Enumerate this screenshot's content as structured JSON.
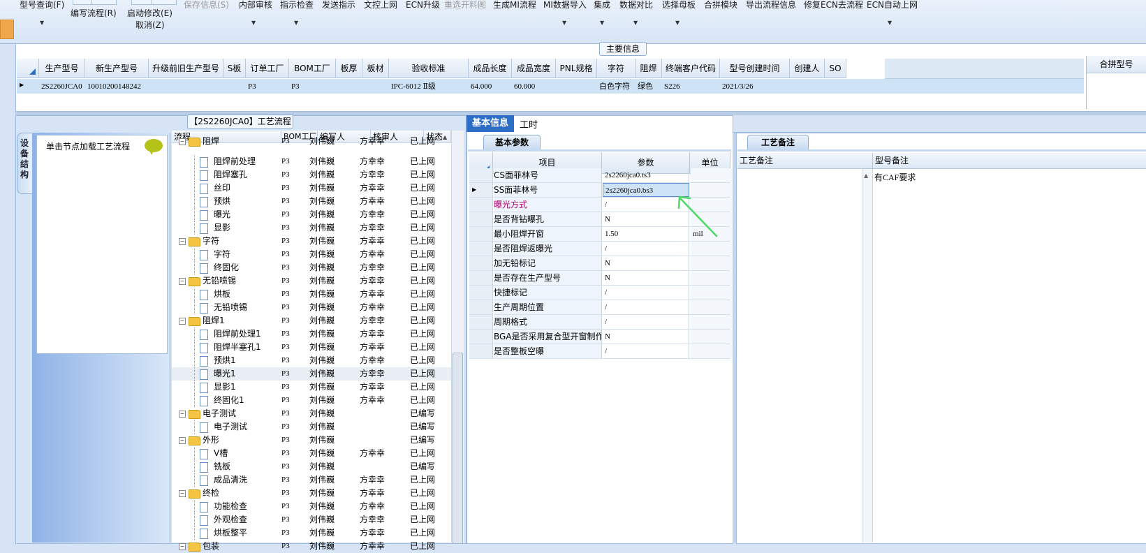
{
  "toolbar": {
    "items": [
      {
        "label": "型号查询(F)",
        "disabled": false
      },
      {
        "label": "编写流程(R)",
        "disabled": false
      },
      {
        "label": "启动修改(E)",
        "disabled": false
      },
      {
        "label": "取消(Z)",
        "disabled": false
      },
      {
        "label": "保存信息(S)",
        "disabled": true
      },
      {
        "label": "内部审核",
        "disabled": false
      },
      {
        "label": "指示检查",
        "disabled": false
      },
      {
        "label": "发送指示",
        "disabled": false
      },
      {
        "label": "文控上网",
        "disabled": false
      },
      {
        "label": "ECN升级",
        "disabled": false
      },
      {
        "label": "重选开料图",
        "disabled": true
      },
      {
        "label": "生成MI流程",
        "disabled": false
      },
      {
        "label": "MI数据导入",
        "disabled": false
      },
      {
        "label": "集成",
        "disabled": false
      },
      {
        "label": "数据对比",
        "disabled": false
      },
      {
        "label": "选择母板",
        "disabled": false
      },
      {
        "label": "合拼模块",
        "disabled": false
      },
      {
        "label": "导出流程信息",
        "disabled": false
      },
      {
        "label": "修复ECN去流程",
        "disabled": false
      },
      {
        "label": "ECN自动上网",
        "disabled": false
      }
    ]
  },
  "main_info": {
    "title": "主要信息",
    "columns": [
      "生产型号",
      "新生产型号",
      "升级前旧生产型号",
      "S板",
      "订单工厂",
      "BOM工厂",
      "板厚",
      "板材",
      "验收标准",
      "成品长度",
      "成品宽度",
      "PNL规格",
      "字符",
      "阻焊",
      "终端客户代码",
      "型号创建时间",
      "创建人",
      "SO"
    ],
    "row": [
      "2S2260JCA0",
      "10010200148242",
      "",
      "",
      "P3",
      "P3",
      "",
      "",
      "IPC-6012 Ⅱ级",
      "64.000",
      "60.000",
      "",
      "白色字符",
      "绿色",
      "S226",
      "2021/3/26",
      "",
      ""
    ],
    "merge_label": "合拼型号"
  },
  "flow_panel": {
    "title": "【2S2260JCA0】工艺流程",
    "side_tab": "设备结构",
    "node_hint": "单击节点加载工艺流程",
    "columns": [
      "流程",
      "BOM工厂",
      "编写人",
      "核审人",
      "状态"
    ],
    "rows": [
      {
        "name": "阻焊",
        "level": 1,
        "bom": "P3",
        "writer": "刘伟巍",
        "reviewer": "方幸幸",
        "status": "已上网",
        "partial": true
      },
      {
        "name": "阻焊前处理",
        "level": 2,
        "bom": "P3",
        "writer": "刘伟巍",
        "reviewer": "方幸幸",
        "status": "已上网"
      },
      {
        "name": "阻焊塞孔",
        "level": 2,
        "bom": "P3",
        "writer": "刘伟巍",
        "reviewer": "方幸幸",
        "status": "已上网"
      },
      {
        "name": "丝印",
        "level": 2,
        "bom": "P3",
        "writer": "刘伟巍",
        "reviewer": "方幸幸",
        "status": "已上网"
      },
      {
        "name": "预烘",
        "level": 2,
        "bom": "P3",
        "writer": "刘伟巍",
        "reviewer": "方幸幸",
        "status": "已上网"
      },
      {
        "name": "曝光",
        "level": 2,
        "bom": "P3",
        "writer": "刘伟巍",
        "reviewer": "方幸幸",
        "status": "已上网"
      },
      {
        "name": "显影",
        "level": 2,
        "bom": "P3",
        "writer": "刘伟巍",
        "reviewer": "方幸幸",
        "status": "已上网"
      },
      {
        "name": "字符",
        "level": 1,
        "bom": "P3",
        "writer": "刘伟巍",
        "reviewer": "方幸幸",
        "status": "已上网"
      },
      {
        "name": "字符",
        "level": 2,
        "bom": "P3",
        "writer": "刘伟巍",
        "reviewer": "方幸幸",
        "status": "已上网"
      },
      {
        "name": "终固化",
        "level": 2,
        "bom": "P3",
        "writer": "刘伟巍",
        "reviewer": "方幸幸",
        "status": "已上网"
      },
      {
        "name": "无铅喷锡",
        "level": 1,
        "bom": "P3",
        "writer": "刘伟巍",
        "reviewer": "方幸幸",
        "status": "已上网"
      },
      {
        "name": "烘板",
        "level": 2,
        "bom": "P3",
        "writer": "刘伟巍",
        "reviewer": "方幸幸",
        "status": "已上网"
      },
      {
        "name": "无铅喷锡",
        "level": 2,
        "bom": "P3",
        "writer": "刘伟巍",
        "reviewer": "方幸幸",
        "status": "已上网"
      },
      {
        "name": "阻焊1",
        "level": 1,
        "bom": "P3",
        "writer": "刘伟巍",
        "reviewer": "方幸幸",
        "status": "已上网"
      },
      {
        "name": "阻焊前处理1",
        "level": 2,
        "bom": "P3",
        "writer": "刘伟巍",
        "reviewer": "方幸幸",
        "status": "已上网"
      },
      {
        "name": "阻焊半塞孔1",
        "level": 2,
        "bom": "P3",
        "writer": "刘伟巍",
        "reviewer": "方幸幸",
        "status": "已上网"
      },
      {
        "name": "预烘1",
        "level": 2,
        "bom": "P3",
        "writer": "刘伟巍",
        "reviewer": "方幸幸",
        "status": "已上网"
      },
      {
        "name": "曝光1",
        "level": 2,
        "bom": "P3",
        "writer": "刘伟巍",
        "reviewer": "方幸幸",
        "status": "已上网",
        "selected": true
      },
      {
        "name": "显影1",
        "level": 2,
        "bom": "P3",
        "writer": "刘伟巍",
        "reviewer": "方幸幸",
        "status": "已上网"
      },
      {
        "name": "终固化1",
        "level": 2,
        "bom": "P3",
        "writer": "刘伟巍",
        "reviewer": "方幸幸",
        "status": "已上网"
      },
      {
        "name": "电子测试",
        "level": 1,
        "bom": "P3",
        "writer": "刘伟巍",
        "reviewer": "",
        "status": "已编写"
      },
      {
        "name": "电子测试",
        "level": 2,
        "bom": "P3",
        "writer": "刘伟巍",
        "reviewer": "",
        "status": "已编写"
      },
      {
        "name": "外形",
        "level": 1,
        "bom": "P3",
        "writer": "刘伟巍",
        "reviewer": "",
        "status": "已编写"
      },
      {
        "name": "V槽",
        "level": 2,
        "bom": "P3",
        "writer": "刘伟巍",
        "reviewer": "方幸幸",
        "status": "已上网"
      },
      {
        "name": "铣板",
        "level": 2,
        "bom": "P3",
        "writer": "刘伟巍",
        "reviewer": "",
        "status": "已编写"
      },
      {
        "name": "成品清洗",
        "level": 2,
        "bom": "P3",
        "writer": "刘伟巍",
        "reviewer": "方幸幸",
        "status": "已上网"
      },
      {
        "name": "终检",
        "level": 1,
        "bom": "P3",
        "writer": "刘伟巍",
        "reviewer": "方幸幸",
        "status": "已上网"
      },
      {
        "name": "功能检查",
        "level": 2,
        "bom": "P3",
        "writer": "刘伟巍",
        "reviewer": "方幸幸",
        "status": "已上网"
      },
      {
        "name": "外观检查",
        "level": 2,
        "bom": "P3",
        "writer": "刘伟巍",
        "reviewer": "方幸幸",
        "status": "已上网"
      },
      {
        "name": "烘板整平",
        "level": 2,
        "bom": "P3",
        "writer": "刘伟巍",
        "reviewer": "方幸幸",
        "status": "已上网"
      },
      {
        "name": "包装",
        "level": 1,
        "bom": "P3",
        "writer": "刘伟巍",
        "reviewer": "方幸幸",
        "status": "已上网",
        "partial": true
      }
    ]
  },
  "basic_info": {
    "tabs": [
      "基本信息",
      "工时"
    ],
    "subtab": "基本参数",
    "columns": [
      "项目",
      "参数",
      "单位"
    ],
    "rows": [
      {
        "item": "CS面菲林号",
        "param": "2s2260jca0.ts3",
        "unit": ""
      },
      {
        "item": "SS面菲林号",
        "param": "2s2260jca0.bs3",
        "unit": "",
        "selected": true
      },
      {
        "item": "曝光方式",
        "param": "/",
        "unit": "",
        "highlight": true
      },
      {
        "item": "是否背钻曝孔",
        "param": "N",
        "unit": ""
      },
      {
        "item": "最小阻焊开窗",
        "param": "1.50",
        "unit": "mil"
      },
      {
        "item": "是否阻焊返曝光",
        "param": "/",
        "unit": ""
      },
      {
        "item": "加无铅标记",
        "param": "N",
        "unit": ""
      },
      {
        "item": "是否存在生产型号",
        "param": "N",
        "unit": ""
      },
      {
        "item": "快捷标记",
        "param": "/",
        "unit": ""
      },
      {
        "item": "生产周期位置",
        "param": "/",
        "unit": ""
      },
      {
        "item": "周期格式",
        "param": "/",
        "unit": ""
      },
      {
        "item": "BGA是否采用复合型开窗制作",
        "param": "N",
        "unit": ""
      },
      {
        "item": "是否整板空曝",
        "param": "/",
        "unit": ""
      }
    ],
    "highlight_color": "#b0006a"
  },
  "process_remark": {
    "tab": "工艺备注",
    "col_process": "工艺备注",
    "col_model": "型号备注",
    "model_remark": "有CAF要求"
  },
  "colors": {
    "accent": "#2c6ec6",
    "selection": "#cfe3f6",
    "arrow": "#4cd964"
  }
}
